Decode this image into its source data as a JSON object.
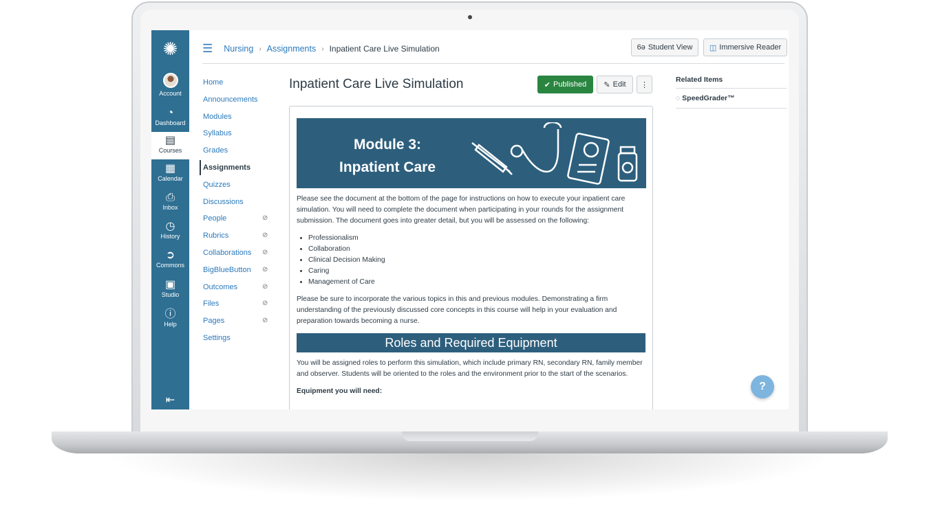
{
  "global_nav": [
    {
      "label": "Account",
      "icon": "avatar"
    },
    {
      "label": "Dashboard",
      "icon": "dashboard-icon"
    },
    {
      "label": "Courses",
      "icon": "book-icon"
    },
    {
      "label": "Calendar",
      "icon": "calendar-icon"
    },
    {
      "label": "Inbox",
      "icon": "inbox-icon"
    },
    {
      "label": "History",
      "icon": "clock-icon"
    },
    {
      "label": "Commons",
      "icon": "commons-icon"
    },
    {
      "label": "Studio",
      "icon": "studio-icon"
    },
    {
      "label": "Help",
      "icon": "help-icon"
    }
  ],
  "breadcrumb": {
    "course": "Nursing",
    "section": "Assignments",
    "current": "Inpatient Care Live Simulation"
  },
  "header": {
    "student_view": "Student View",
    "immersive_reader": "Immersive Reader"
  },
  "course_nav": [
    {
      "label": "Home"
    },
    {
      "label": "Announcements"
    },
    {
      "label": "Modules"
    },
    {
      "label": "Syllabus"
    },
    {
      "label": "Grades"
    },
    {
      "label": "Assignments",
      "active": true
    },
    {
      "label": "Quizzes"
    },
    {
      "label": "Discussions"
    },
    {
      "label": "People",
      "hidden": true
    },
    {
      "label": "Rubrics",
      "hidden": true
    },
    {
      "label": "Collaborations",
      "hidden": true
    },
    {
      "label": "BigBlueButton",
      "hidden": true
    },
    {
      "label": "Outcomes",
      "hidden": true
    },
    {
      "label": "Files",
      "hidden": true
    },
    {
      "label": "Pages",
      "hidden": true
    },
    {
      "label": "Settings"
    }
  ],
  "page": {
    "title": "Inpatient Care Live Simulation",
    "published": "Published",
    "edit": "Edit",
    "banner_line1": "Module 3:",
    "banner_line2": "Inpatient Care",
    "intro": "Please see the document at the bottom of the page for instructions on how to execute your inpatient care simulation. You will need to complete the document when participating in your rounds for the assignment submission. The document goes into greater detail, but you will be assessed on the following:",
    "criteria": [
      "Professionalism",
      "Collaboration",
      "Clinical Decision Making",
      "Caring",
      "Management of Care"
    ],
    "para2": "Please be sure to incorporate the various topics in this and previous modules. Demonstrating a firm understanding of the previously discussed core concepts in this course will help in your evaluation and preparation towards becoming a nurse.",
    "heading2": "Roles and Required Equipment",
    "para3": "You will be assigned roles to perform this simulation, which include primary RN, secondary RN, family member and observer. Students will be oriented to the roles and the environment prior to the start of the scenarios.",
    "equipment": "Equipment you will need:"
  },
  "related": {
    "title": "Related Items",
    "speedgrader": "SpeedGrader™"
  },
  "colors": {
    "nav": "#2e6f92",
    "published": "#2a8540",
    "link": "#2b7abc",
    "banner": "#2d5f7d"
  }
}
